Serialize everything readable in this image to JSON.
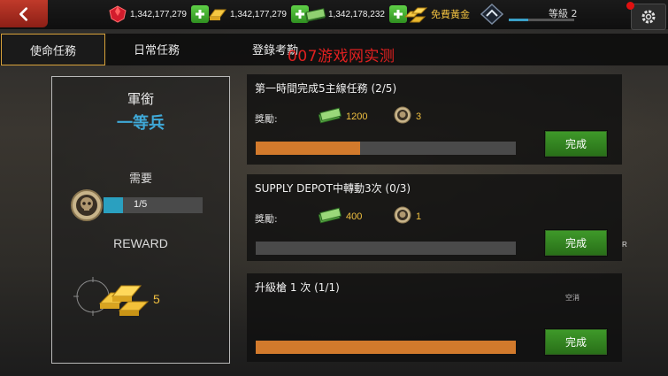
{
  "resources": {
    "gems": "1,342,177,279",
    "gold": "1,342,177,279",
    "cash": "1,342,178,232",
    "free_gold_label": "免費黃金"
  },
  "level": {
    "label": "等級 2",
    "progress": 0.3
  },
  "tabs": [
    "使命任務",
    "日常任務",
    "登錄考勤"
  ],
  "active_tab": 0,
  "watermark": "007游戏网实测",
  "rank_panel": {
    "label": "軍銜",
    "value": "一等兵",
    "need_label": "需要",
    "need_count": "1/5",
    "need_progress": 0.2,
    "reward_label": "REWARD",
    "reward_count": "5"
  },
  "missions": [
    {
      "title": "第一時間完成5主線任務 (2/5)",
      "reward_label": "獎勵:",
      "cash": "1200",
      "coins": "3",
      "progress": 0.4,
      "button": "完成"
    },
    {
      "title": "SUPPLY DEPOT中轉動3次  (0/3)",
      "reward_label": "獎勵:",
      "cash": "400",
      "coins": "1",
      "progress": 0,
      "button": "完成"
    },
    {
      "title": "升級槍 1 次 (1/1)",
      "tag": "空消",
      "progress": 1,
      "button": "完成"
    }
  ],
  "side_mark": "R",
  "colors": {
    "accent_blue": "#3fa9d8",
    "progress_orange": "#d27a2c",
    "button_green": "#3f9a2a",
    "gold_text": "#f0c040"
  }
}
